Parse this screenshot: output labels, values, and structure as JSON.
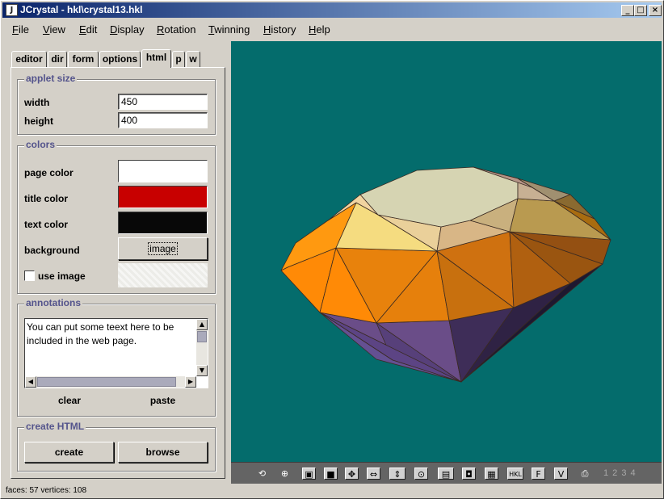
{
  "window": {
    "title": "JCrystal - hkl\\crystal13.hkl"
  },
  "menu": [
    "File",
    "View",
    "Edit",
    "Display",
    "Rotation",
    "Twinning",
    "History",
    "Help"
  ],
  "tabs": [
    "editor",
    "dir",
    "form",
    "options",
    "html",
    "p",
    "w"
  ],
  "active_tab": "html",
  "applet_size": {
    "title": "applet size",
    "width_label": "width",
    "width_value": "450",
    "height_label": "height",
    "height_value": "400"
  },
  "colors": {
    "title": "colors",
    "page_color_label": "page color",
    "page_color": "#ffffff",
    "title_color_label": "title color",
    "title_color": "#c80000",
    "text_color_label": "text color",
    "text_color": "#080808",
    "background_label": "background",
    "background_button": "image",
    "use_image_label": "use image"
  },
  "annotations": {
    "title": "annotations",
    "text": "You can put some teext here to be included in the web page.",
    "clear_label": "clear",
    "paste_label": "paste"
  },
  "create_html": {
    "title": "create HTML",
    "create_label": "create",
    "browse_label": "browse"
  },
  "viewport": {
    "background": "#046c6c"
  },
  "toolbar": {
    "icons": [
      "rotate-tool-icon",
      "zoom-tool-icon",
      "frame-icon",
      "square-icon",
      "move-icon",
      "move-horizontal-icon",
      "move-vertical-icon",
      "magnify-icon",
      "fit-icon",
      "crop-icon",
      "image-icon",
      "hkl-icon",
      "f-icon",
      "v-icon",
      "print-icon"
    ],
    "glyphs": [
      "⟲",
      "⊕",
      "▣",
      "■",
      "✥",
      "⇔",
      "⇕",
      "⊙",
      "▤",
      "◘",
      "▦",
      "HKL",
      "F",
      "V",
      "⎙"
    ],
    "page_numbers": "1 2 3 4"
  },
  "status": {
    "text": "faces: 57  vertices: 108"
  }
}
